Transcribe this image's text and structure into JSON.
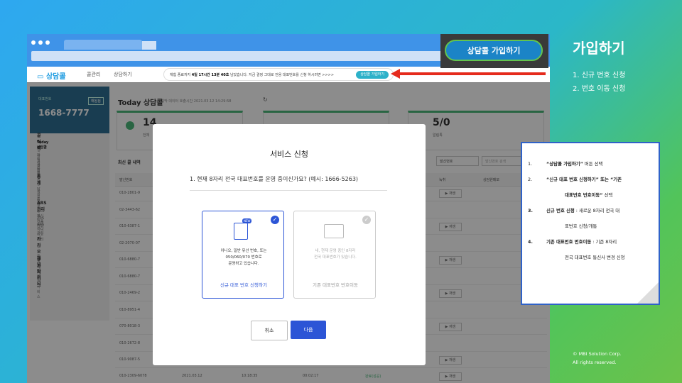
{
  "app": {
    "logo": "상담콜",
    "nav": [
      "콜관리",
      "상담하기"
    ],
    "banner": {
      "text_pre": "체험 종료까지 ",
      "text_bold": "4일 17시간 13분 40초",
      "text_post": " 남았습니다. 지금 결정 그대로 전용 대표번호를 신청 하시려면 >>>>",
      "button": "상담콜 가입하기"
    }
  },
  "sidebar": {
    "card_label": "대표번호",
    "card_number": "1668-7777",
    "card_button": "해됨됨",
    "groups": [
      {
        "title": "콜 이력",
        "items": [
          "Today 상담콜",
          "일자별 상담콜",
          "콜 고객 리스트",
          "알림톡 발송"
        ]
      },
      {
        "title": "통계",
        "items": [
          "상담콜 통계",
          "착신번호 통계"
        ]
      },
      {
        "title": "ARS 관리",
        "items": [
          "ARS 착신번호 관리",
          "ARS 운영시간 관리",
          "ARS 시나리오 관리"
        ]
      },
      {
        "title": "카카오 채널 아이디",
        "items": [
          "알림톡 연동정보"
        ]
      },
      {
        "title": "부가서비스",
        "items": [
          "녹취 보관 서비스"
        ]
      }
    ]
  },
  "main": {
    "title": "Today 상담콜",
    "subtitle": "마지막 데이터 호출시간  2021.03.12 14:29:58",
    "stats": [
      {
        "value": "14",
        "label": "전체"
      },
      {
        "value": "5/0",
        "label": "알림톡"
      }
    ],
    "list_header": "최신 콜 내역",
    "filter_select": "발신번호",
    "filter_placeholder": "발신번호 검색",
    "columns": [
      "발신번호",
      "녹취",
      "상담원메모"
    ],
    "rows": [
      "010-2801-9",
      "02-3443-62",
      "010-6387-1",
      "02-2070-07",
      "010-6880-7",
      "010-6880-7",
      "010-2469-2",
      "010-8951-4",
      "070-8018-3",
      "010-2672-8",
      "010-9087-5"
    ],
    "last_row": {
      "number": "010-2309-6078",
      "date": "2021.03.12",
      "time": "10:18:35",
      "duration": "00:02:17",
      "status": "완료(성공)"
    },
    "play_label": "▶ 재생"
  },
  "modal": {
    "title": "서비스 신청",
    "question": "1. 현재 8자리 전국 대표번호를 운영 중이신가요? (예시: 1666-5263)",
    "option_new": {
      "desc": [
        "아니오, 일반 유선 번호, 또는",
        "050/060/070 번호로",
        "운영하고 있습니다."
      ],
      "label": "신규 대표 번호 신청하기",
      "badge": "NEW"
    },
    "option_transfer": {
      "desc": [
        "네, 현재 운영 중인 8자리",
        "전국 대표번호가 있습니다."
      ],
      "label": "기존 대표번호 번호이동"
    },
    "cancel": "취소",
    "confirm": "다음"
  },
  "highlight_button": "상담콜 가입하기",
  "panel": {
    "title": "가입하기",
    "steps": [
      "1.   신규 번호 신청",
      "2.   번호 이동 신청"
    ],
    "notes": [
      {
        "num": "1.",
        "bold": "“상담콜 가입하기”",
        "text": " 버튼 선택"
      },
      {
        "num": "2.",
        "bold": "“신규 대표 번호 신청하기” 또는 “기존",
        "text": ""
      },
      {
        "num": "",
        "bold": "대표번호 번호이동”",
        "text": " 선택"
      },
      {
        "num": "3.",
        "bold": "신규 번호 신청",
        "text": " : 새로운 8자리 전국 대"
      },
      {
        "num": "",
        "bold": "",
        "text": "표번호 신청/개통"
      },
      {
        "num": "4.",
        "bold": "기존 대표번호 번호이동",
        "text": " : 기존 8자리"
      },
      {
        "num": "",
        "bold": "",
        "text": "전국 대표번호 통신사 변경 신청"
      }
    ],
    "copyright": [
      "© MBI Solution Corp.",
      "All rights reserved."
    ]
  },
  "colors": {
    "accent_blue": "#2c55d6",
    "arrow_red": "#e52a1c",
    "join_blue": "#1b84c7",
    "join_border": "#63c44e"
  }
}
